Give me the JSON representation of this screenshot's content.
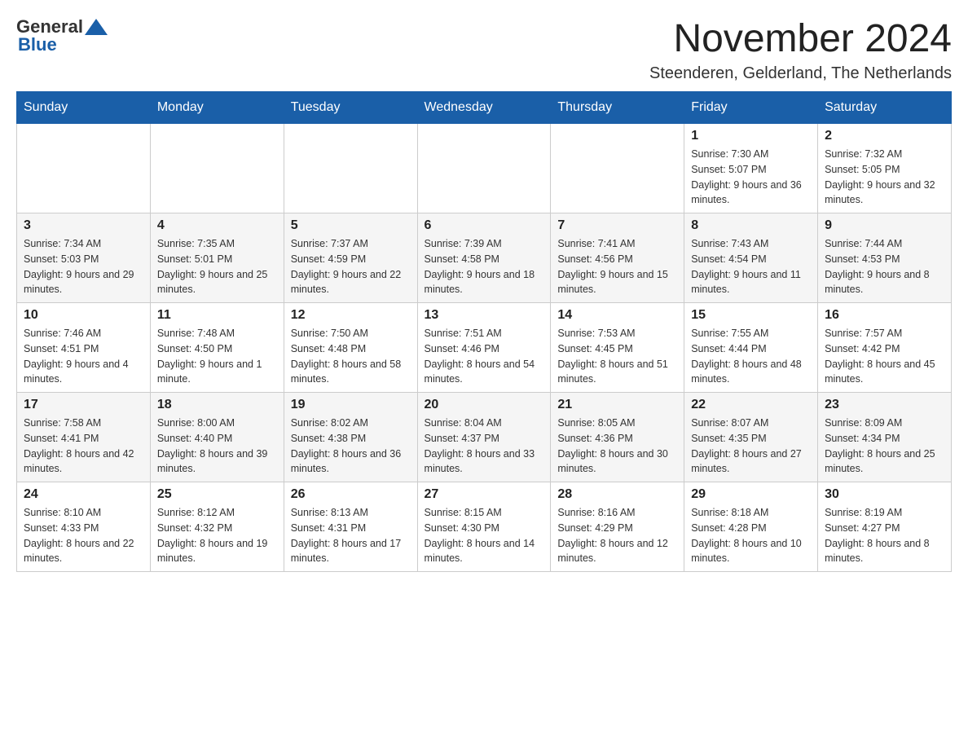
{
  "header": {
    "logo": {
      "text_general": "General",
      "text_blue": "Blue"
    },
    "title": "November 2024",
    "subtitle": "Steenderen, Gelderland, The Netherlands"
  },
  "weekdays": [
    "Sunday",
    "Monday",
    "Tuesday",
    "Wednesday",
    "Thursday",
    "Friday",
    "Saturday"
  ],
  "weeks": [
    [
      {
        "day": "",
        "sunrise": "",
        "sunset": "",
        "daylight": ""
      },
      {
        "day": "",
        "sunrise": "",
        "sunset": "",
        "daylight": ""
      },
      {
        "day": "",
        "sunrise": "",
        "sunset": "",
        "daylight": ""
      },
      {
        "day": "",
        "sunrise": "",
        "sunset": "",
        "daylight": ""
      },
      {
        "day": "",
        "sunrise": "",
        "sunset": "",
        "daylight": ""
      },
      {
        "day": "1",
        "sunrise": "Sunrise: 7:30 AM",
        "sunset": "Sunset: 5:07 PM",
        "daylight": "Daylight: 9 hours and 36 minutes."
      },
      {
        "day": "2",
        "sunrise": "Sunrise: 7:32 AM",
        "sunset": "Sunset: 5:05 PM",
        "daylight": "Daylight: 9 hours and 32 minutes."
      }
    ],
    [
      {
        "day": "3",
        "sunrise": "Sunrise: 7:34 AM",
        "sunset": "Sunset: 5:03 PM",
        "daylight": "Daylight: 9 hours and 29 minutes."
      },
      {
        "day": "4",
        "sunrise": "Sunrise: 7:35 AM",
        "sunset": "Sunset: 5:01 PM",
        "daylight": "Daylight: 9 hours and 25 minutes."
      },
      {
        "day": "5",
        "sunrise": "Sunrise: 7:37 AM",
        "sunset": "Sunset: 4:59 PM",
        "daylight": "Daylight: 9 hours and 22 minutes."
      },
      {
        "day": "6",
        "sunrise": "Sunrise: 7:39 AM",
        "sunset": "Sunset: 4:58 PM",
        "daylight": "Daylight: 9 hours and 18 minutes."
      },
      {
        "day": "7",
        "sunrise": "Sunrise: 7:41 AM",
        "sunset": "Sunset: 4:56 PM",
        "daylight": "Daylight: 9 hours and 15 minutes."
      },
      {
        "day": "8",
        "sunrise": "Sunrise: 7:43 AM",
        "sunset": "Sunset: 4:54 PM",
        "daylight": "Daylight: 9 hours and 11 minutes."
      },
      {
        "day": "9",
        "sunrise": "Sunrise: 7:44 AM",
        "sunset": "Sunset: 4:53 PM",
        "daylight": "Daylight: 9 hours and 8 minutes."
      }
    ],
    [
      {
        "day": "10",
        "sunrise": "Sunrise: 7:46 AM",
        "sunset": "Sunset: 4:51 PM",
        "daylight": "Daylight: 9 hours and 4 minutes."
      },
      {
        "day": "11",
        "sunrise": "Sunrise: 7:48 AM",
        "sunset": "Sunset: 4:50 PM",
        "daylight": "Daylight: 9 hours and 1 minute."
      },
      {
        "day": "12",
        "sunrise": "Sunrise: 7:50 AM",
        "sunset": "Sunset: 4:48 PM",
        "daylight": "Daylight: 8 hours and 58 minutes."
      },
      {
        "day": "13",
        "sunrise": "Sunrise: 7:51 AM",
        "sunset": "Sunset: 4:46 PM",
        "daylight": "Daylight: 8 hours and 54 minutes."
      },
      {
        "day": "14",
        "sunrise": "Sunrise: 7:53 AM",
        "sunset": "Sunset: 4:45 PM",
        "daylight": "Daylight: 8 hours and 51 minutes."
      },
      {
        "day": "15",
        "sunrise": "Sunrise: 7:55 AM",
        "sunset": "Sunset: 4:44 PM",
        "daylight": "Daylight: 8 hours and 48 minutes."
      },
      {
        "day": "16",
        "sunrise": "Sunrise: 7:57 AM",
        "sunset": "Sunset: 4:42 PM",
        "daylight": "Daylight: 8 hours and 45 minutes."
      }
    ],
    [
      {
        "day": "17",
        "sunrise": "Sunrise: 7:58 AM",
        "sunset": "Sunset: 4:41 PM",
        "daylight": "Daylight: 8 hours and 42 minutes."
      },
      {
        "day": "18",
        "sunrise": "Sunrise: 8:00 AM",
        "sunset": "Sunset: 4:40 PM",
        "daylight": "Daylight: 8 hours and 39 minutes."
      },
      {
        "day": "19",
        "sunrise": "Sunrise: 8:02 AM",
        "sunset": "Sunset: 4:38 PM",
        "daylight": "Daylight: 8 hours and 36 minutes."
      },
      {
        "day": "20",
        "sunrise": "Sunrise: 8:04 AM",
        "sunset": "Sunset: 4:37 PM",
        "daylight": "Daylight: 8 hours and 33 minutes."
      },
      {
        "day": "21",
        "sunrise": "Sunrise: 8:05 AM",
        "sunset": "Sunset: 4:36 PM",
        "daylight": "Daylight: 8 hours and 30 minutes."
      },
      {
        "day": "22",
        "sunrise": "Sunrise: 8:07 AM",
        "sunset": "Sunset: 4:35 PM",
        "daylight": "Daylight: 8 hours and 27 minutes."
      },
      {
        "day": "23",
        "sunrise": "Sunrise: 8:09 AM",
        "sunset": "Sunset: 4:34 PM",
        "daylight": "Daylight: 8 hours and 25 minutes."
      }
    ],
    [
      {
        "day": "24",
        "sunrise": "Sunrise: 8:10 AM",
        "sunset": "Sunset: 4:33 PM",
        "daylight": "Daylight: 8 hours and 22 minutes."
      },
      {
        "day": "25",
        "sunrise": "Sunrise: 8:12 AM",
        "sunset": "Sunset: 4:32 PM",
        "daylight": "Daylight: 8 hours and 19 minutes."
      },
      {
        "day": "26",
        "sunrise": "Sunrise: 8:13 AM",
        "sunset": "Sunset: 4:31 PM",
        "daylight": "Daylight: 8 hours and 17 minutes."
      },
      {
        "day": "27",
        "sunrise": "Sunrise: 8:15 AM",
        "sunset": "Sunset: 4:30 PM",
        "daylight": "Daylight: 8 hours and 14 minutes."
      },
      {
        "day": "28",
        "sunrise": "Sunrise: 8:16 AM",
        "sunset": "Sunset: 4:29 PM",
        "daylight": "Daylight: 8 hours and 12 minutes."
      },
      {
        "day": "29",
        "sunrise": "Sunrise: 8:18 AM",
        "sunset": "Sunset: 4:28 PM",
        "daylight": "Daylight: 8 hours and 10 minutes."
      },
      {
        "day": "30",
        "sunrise": "Sunrise: 8:19 AM",
        "sunset": "Sunset: 4:27 PM",
        "daylight": "Daylight: 8 hours and 8 minutes."
      }
    ]
  ]
}
